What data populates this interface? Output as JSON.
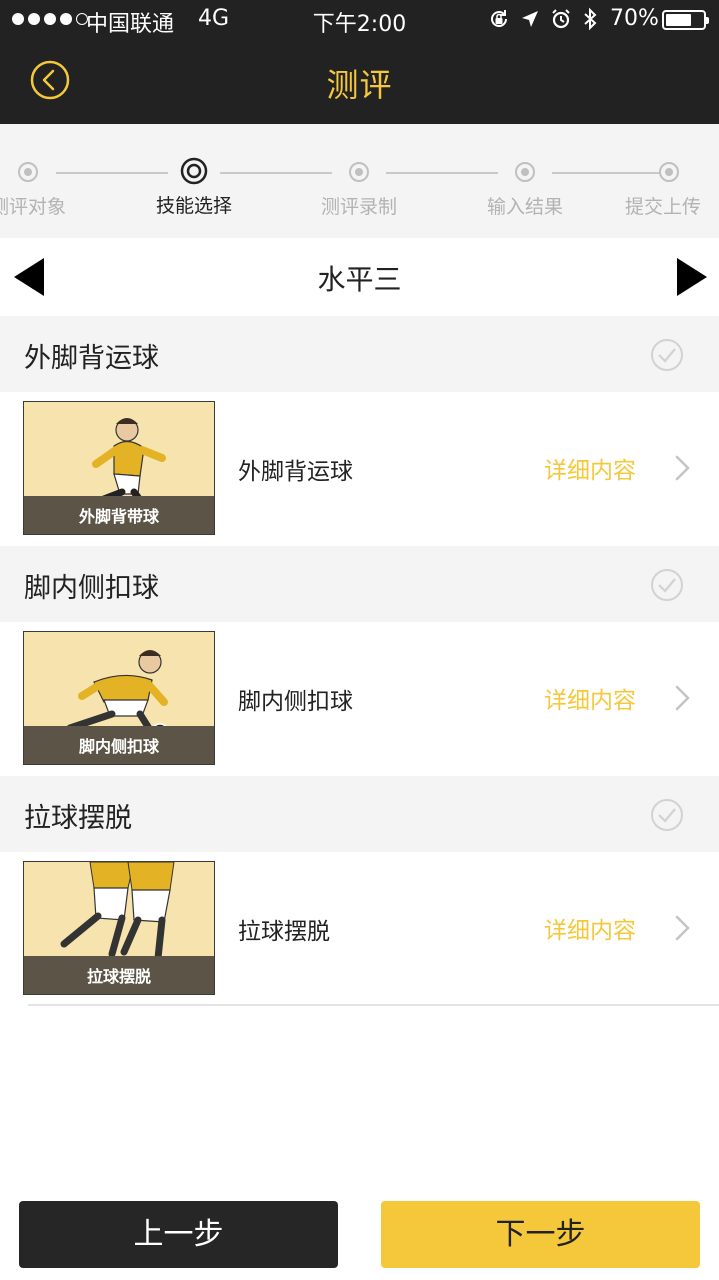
{
  "status_bar": {
    "carrier": "中国联通",
    "network": "4G",
    "time": "下午2:00",
    "battery": "70%",
    "battery_level": 0.7
  },
  "header": {
    "title": "测评"
  },
  "stepper": {
    "steps": [
      {
        "label": "测评对象",
        "active": false
      },
      {
        "label": "技能选择",
        "active": true
      },
      {
        "label": "测评录制",
        "active": false
      },
      {
        "label": "输入结果",
        "active": false
      },
      {
        "label": "提交上传",
        "active": false
      }
    ]
  },
  "level": {
    "title": "水平三"
  },
  "skills": [
    {
      "group_title": "外脚背运球",
      "thumb_caption": "外脚背带球",
      "name": "外脚背运球",
      "detail_label": "详细内容"
    },
    {
      "group_title": "脚内侧扣球",
      "thumb_caption": "脚内侧扣球",
      "name": "脚内侧扣球",
      "detail_label": "详细内容"
    },
    {
      "group_title": "拉球摆脱",
      "thumb_caption": "拉球摆脱",
      "name": "拉球摆脱",
      "detail_label": "详细内容"
    }
  ],
  "footer": {
    "prev_label": "上一步",
    "next_label": "下一步"
  },
  "colors": {
    "accent": "#f5c83c",
    "dark": "#222222",
    "section_bg": "#f4f4f4"
  }
}
